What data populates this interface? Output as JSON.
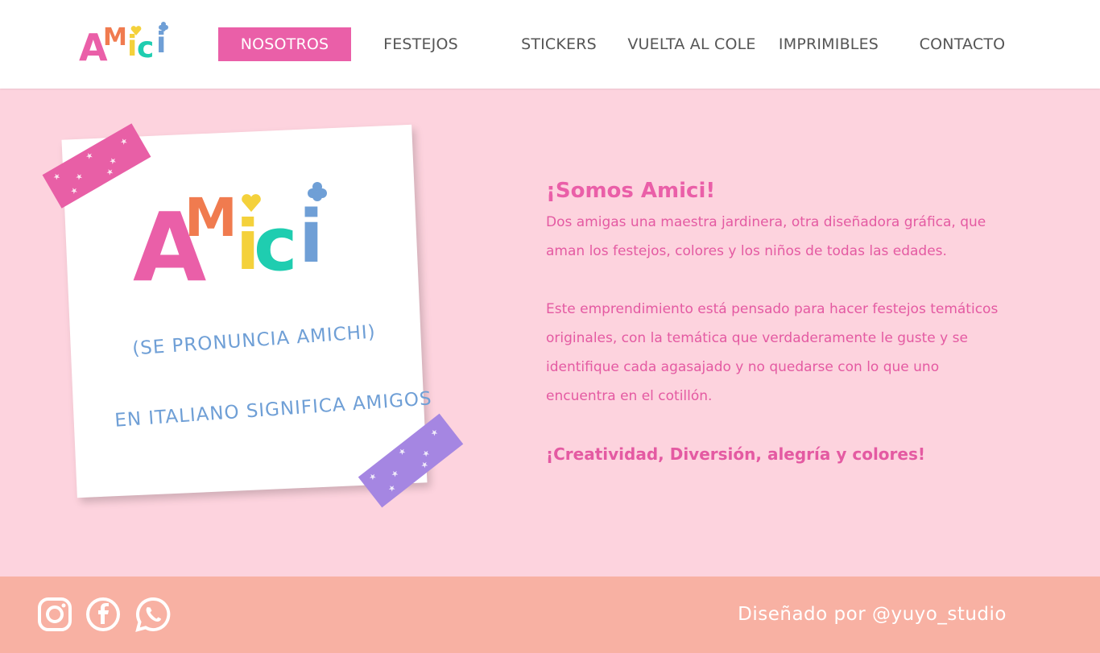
{
  "brand": {
    "logo_letters": [
      "A",
      "M",
      "i",
      "c",
      "i"
    ],
    "colors": {
      "pink": "#ea5fa8",
      "orange": "#f07b4f",
      "yellow": "#f4d13b",
      "teal": "#1fcdb0",
      "blue": "#6f9fd6",
      "background": "#fdd3de",
      "footer": "#f8b1a3"
    }
  },
  "nav": {
    "items": [
      {
        "label": "NOSOTROS",
        "active": true
      },
      {
        "label": "FESTEJOS",
        "active": false
      },
      {
        "label": "STICKERS",
        "active": false
      },
      {
        "label": "VUELTA AL COLE",
        "active": false
      },
      {
        "label": "IMPRIMIBLES",
        "active": false
      },
      {
        "label": "CONTACTO",
        "active": false
      }
    ]
  },
  "note": {
    "pronunciation": "(SE PRONUNCIA AMICHI)",
    "meaning": "EN ITALIANO SIGNIFICA AMIGOS"
  },
  "about": {
    "title": "¡Somos Amici!",
    "paragraph1": "Dos amigas una maestra jardinera, otra diseñadora gráfica, que aman los festejos, colores y los niños de todas las edades.",
    "paragraph2": "Este emprendimiento está pensado para hacer festejos temáticos originales, con la temática que verdaderamente le guste y se identifique cada agasajado y no quedarse con lo que uno encuentra en el cotillón.",
    "slogan": "¡Creatividad, Diversión, alegría y colores!"
  },
  "footer": {
    "icons": [
      "instagram-icon",
      "facebook-icon",
      "whatsapp-icon"
    ],
    "credit": "Diseñado por @yuyo_studio"
  }
}
